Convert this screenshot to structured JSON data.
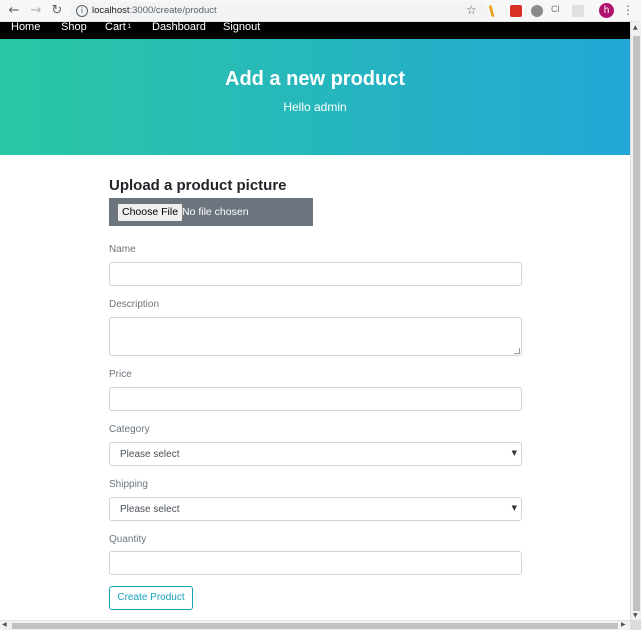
{
  "browser": {
    "url_host": "localhost",
    "url_path": ":3000/create/product",
    "avatar_letter": "h",
    "colors": {
      "avatar": "#b0126f"
    }
  },
  "nav": {
    "items": [
      {
        "label": "Home"
      },
      {
        "label": "Shop"
      },
      {
        "label": "Cart",
        "badge": "1"
      },
      {
        "label": "Dashboard"
      },
      {
        "label": "Signout"
      }
    ]
  },
  "hero": {
    "title": "Add a new product",
    "subtitle": "Hello admin",
    "colors": {
      "start": "#2bc7a4",
      "end": "#22a7d6"
    }
  },
  "form": {
    "upload_title": "Upload a product picture",
    "choose_file_label": "Choose File",
    "no_file_text": "No file chosen",
    "name_label": "Name",
    "name_value": "",
    "description_label": "Description",
    "description_value": "",
    "price_label": "Price",
    "price_value": "",
    "category_label": "Category",
    "category_selected": "Please select",
    "shipping_label": "Shipping",
    "shipping_selected": "Please select",
    "quantity_label": "Quantity",
    "quantity_value": "",
    "submit_label": "Create Product"
  }
}
